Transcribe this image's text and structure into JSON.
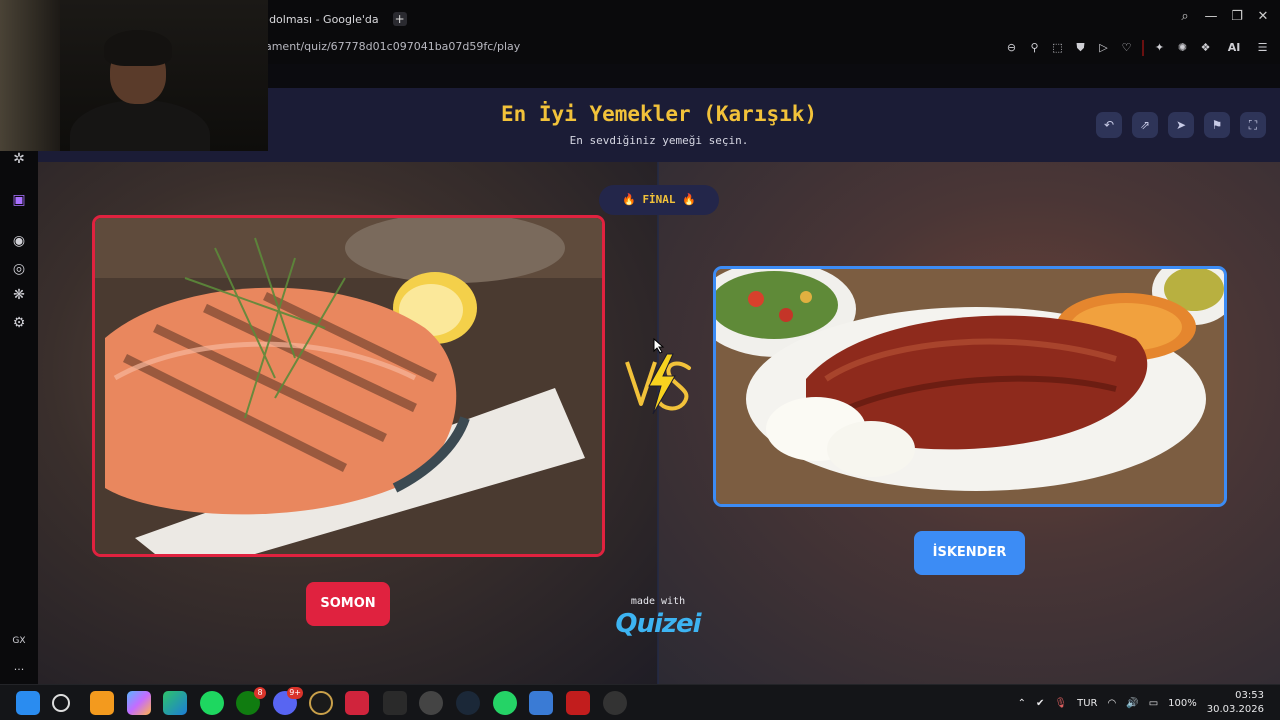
{
  "browser": {
    "tab_title": "ır dolması - Google'da",
    "new_tab": "+",
    "url": "nament/quiz/67778d01c097041ba07d59fc/play",
    "ai_label": "AI",
    "sidebar_bottom_label": "GX",
    "sidebar_more": "..."
  },
  "quiz": {
    "title": "En İyi Yemekler (Karışık)",
    "subtitle": "En sevdiğiniz yemeği seçin.",
    "round_badge": "FİNAL",
    "round_emoji": "🔥",
    "left_choice": "SOMON",
    "right_choice": "İSKENDER",
    "made_with": "made with",
    "brand": "Quizei",
    "colors": {
      "title": "#f2c23a",
      "left_accent": "#e0223f",
      "right_accent": "#3c8cf5",
      "header_bg": "#1b1c36"
    }
  },
  "taskbar": {
    "language": "TUR",
    "battery": "100%",
    "time": "03:53",
    "date": "30.03.2026",
    "badges": {
      "xbox": "8",
      "discord": "9+"
    },
    "icons": [
      "windows-start-icon",
      "search-icon",
      "brave-icon",
      "copilot-icon",
      "edge-icon",
      "spotify-icon",
      "xbox-icon",
      "discord-icon",
      "opera-gx-icon",
      "ubisoft-icon",
      "epic-games-icon",
      "media-player-icon",
      "steam-icon",
      "whatsapp-icon",
      "app-icon",
      "voicemeeter-icon",
      "settings-app-icon"
    ]
  }
}
